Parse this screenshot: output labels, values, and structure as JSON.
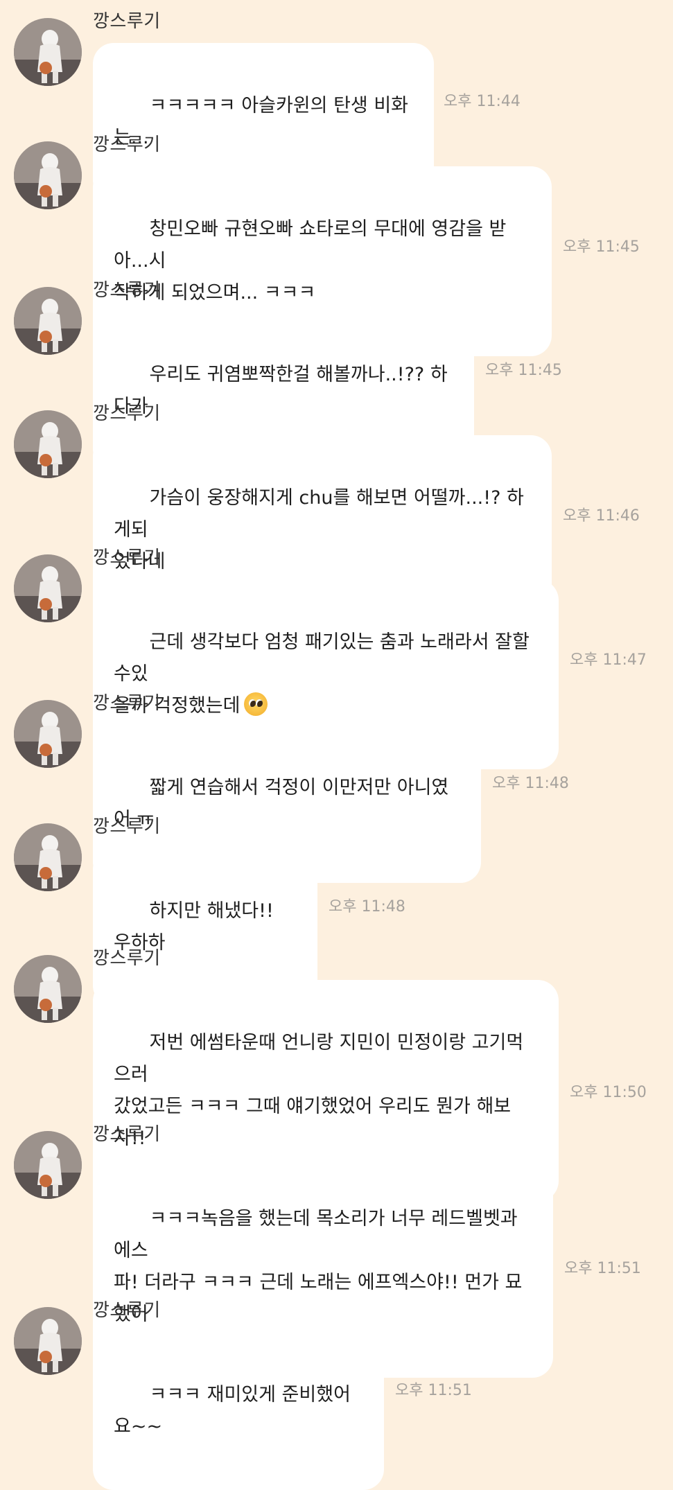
{
  "sender_name": "깡스루기",
  "messages": [
    {
      "text": "ㅋㅋㅋㅋㅋ 아슬카윈의 탄생 비화는...",
      "time": "오후 11:44"
    },
    {
      "text": "창민오빠 규현오빠 쇼타로의 무대에 영감을 받아...시\n작하게 되었으며... ㅋㅋㅋ",
      "time": "오후 11:45"
    },
    {
      "text": "우리도 귀염뽀짝한걸 해볼까나..!?? 하다가",
      "time": "오후 11:45"
    },
    {
      "text": "가슴이 웅장해지게 chu를 해보면 어떨까...!? 하게되\n었다네",
      "time": "오후 11:46"
    },
    {
      "text": "근데 생각보다 엄청 패기있는 춤과 노래라서 잘할수있\n을까 걱정했는데",
      "time": "오후 11:47",
      "emoji": "pleading-face"
    },
    {
      "text": "짧게 연습해서 걱정이 이만저만 아니였어 ㅠ",
      "time": "오후 11:48"
    },
    {
      "text": "하지만 해냈다!! 우하하",
      "time": "오후 11:48"
    },
    {
      "text": "저번 에썸타운때 언니랑 지민이 민정이랑 고기먹으러\n갔었고든 ㅋㅋㅋ 그때 얘기했었어 우리도 뭔가 해보\n자!!",
      "time": "오후 11:50"
    },
    {
      "text": "ㅋㅋㅋ녹음을 했는데 목소리가 너무 레드벨벳과 에스\n파! 더라구 ㅋㅋㅋ 근데 노래는 에프엑스야!! 먼가 묘\n했어",
      "time": "오후 11:51"
    },
    {
      "text": "ㅋㅋㅋ 재미있게 준비했어요~~",
      "time": "오후 11:51"
    }
  ]
}
